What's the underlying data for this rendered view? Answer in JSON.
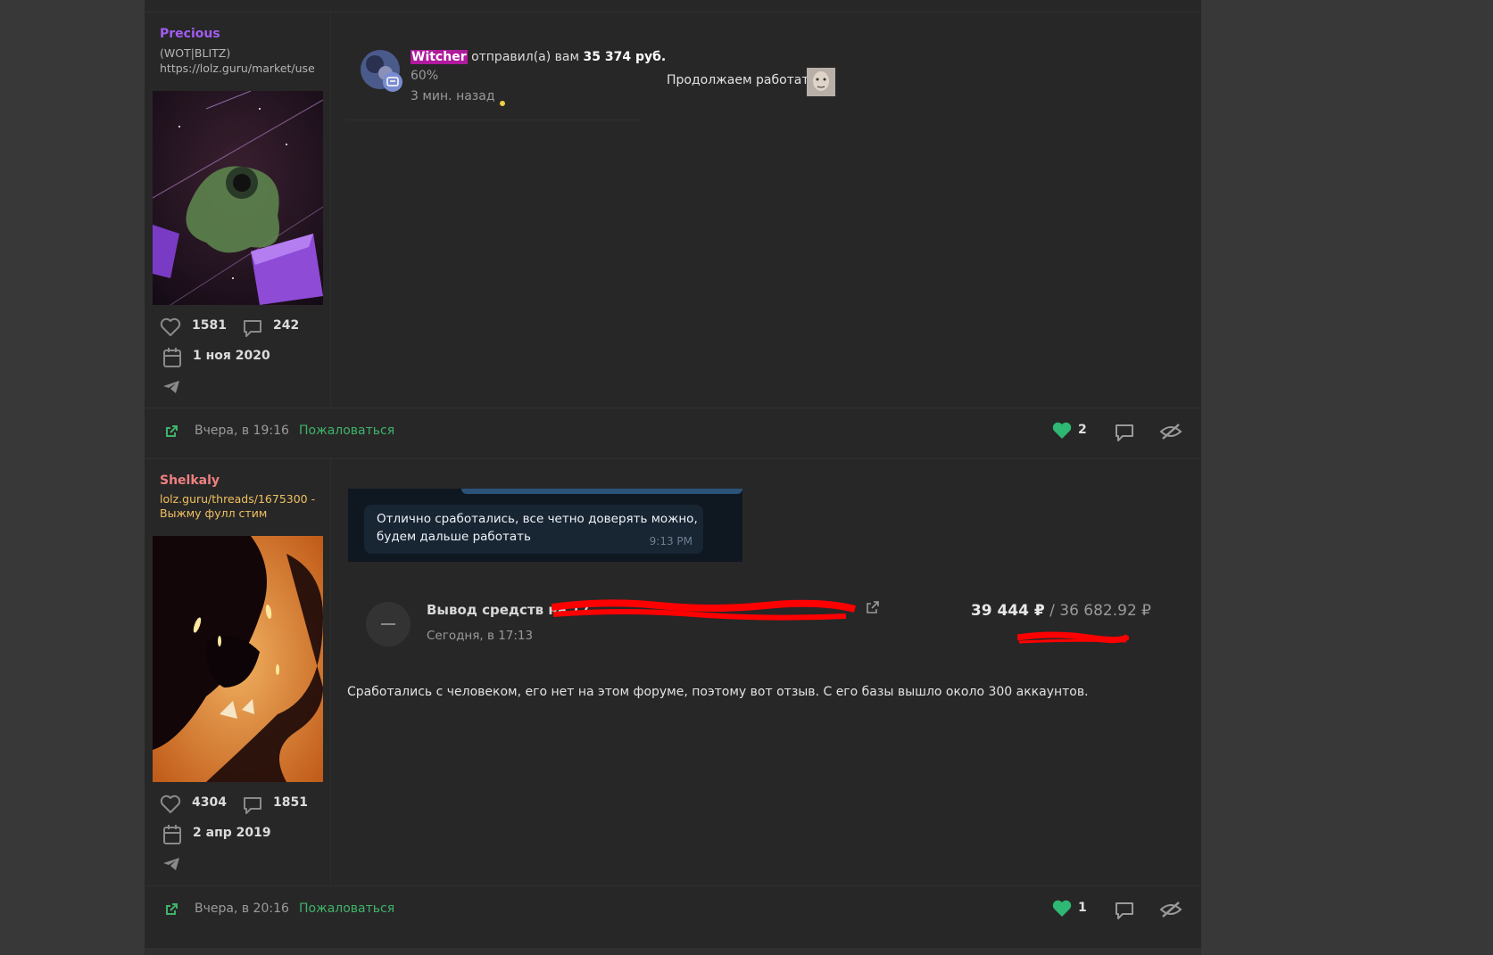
{
  "posts": [
    {
      "username": "Precious",
      "user_title_line1": "(WOT|BLITZ)",
      "user_title_line2": "https://lolz.guru/market/use",
      "likes": "1581",
      "messages": "242",
      "registered": "1 ноя 2020",
      "quote": {
        "sender": "Witcher",
        "action": "отправил(а) вам",
        "amount": "35 374 руб.",
        "percent": "60%",
        "time": "3 мин. назад"
      },
      "message": "Продолжаем работать",
      "footer": {
        "time": "Вчера, в 19:16",
        "report": "Пожаловаться",
        "like_count": "2"
      }
    },
    {
      "username": "Shelkaly",
      "user_title_line1": "lolz.guru/threads/1675300 -",
      "user_title_line2": "Выжму фулл стим",
      "likes": "4304",
      "messages": "1851",
      "registered": "2 апр 2019",
      "chat": {
        "line1": "Отлично сработались, все четно доверять можно,",
        "line2": "будем дальше работать",
        "time": "9:13 PM"
      },
      "withdrawal": {
        "title": "Вывод средств на 17",
        "time": "Сегодня, в 17:13",
        "amount": "39 444 ₽",
        "separator": "/",
        "amount_secondary": "36 682.92 ₽"
      },
      "message": "Сработались с человеком, его нет на этом форуме, поэтому вот отзыв. С его базы вышло около 300 аккаунтов.",
      "footer": {
        "time": "Вчера, в 20:16",
        "report": "Пожаловаться",
        "like_count": "1"
      }
    }
  ],
  "colors": {
    "username_1": "#a25cf0",
    "username_2": "#f08080",
    "user_title_2": "#f0c060",
    "accent_green": "#3fb36a",
    "redaction": "#ff0000"
  }
}
